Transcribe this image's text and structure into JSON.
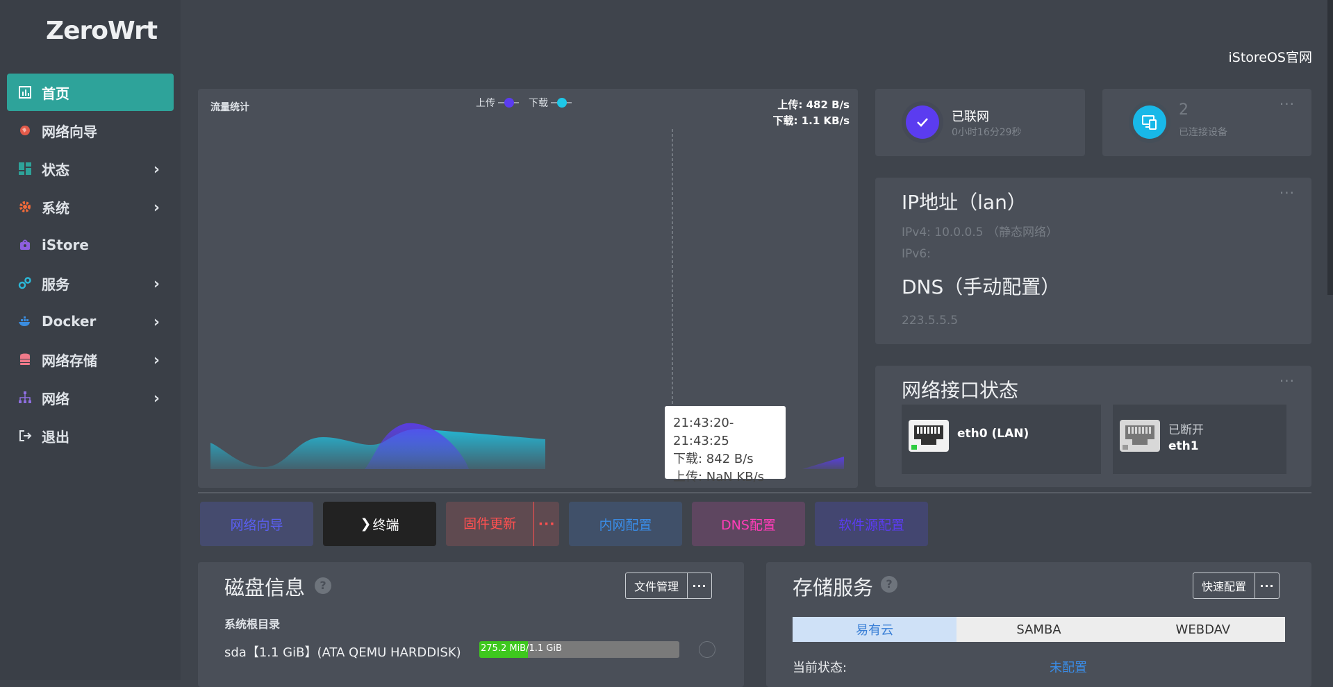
{
  "app": {
    "logo": "ZeroWrt",
    "top_link": "iStoreOS官网"
  },
  "sidebar": {
    "items": [
      {
        "label": "首页",
        "icon": "dashboard-icon",
        "active": true,
        "has_children": false
      },
      {
        "label": "网络向导",
        "icon": "globe-icon",
        "active": false,
        "has_children": false
      },
      {
        "label": "状态",
        "icon": "grid-icon",
        "active": false,
        "has_children": true
      },
      {
        "label": "系统",
        "icon": "gear-icon",
        "active": false,
        "has_children": true
      },
      {
        "label": "iStore",
        "icon": "store-icon",
        "active": false,
        "has_children": false
      },
      {
        "label": "服务",
        "icon": "services-icon",
        "active": false,
        "has_children": true
      },
      {
        "label": "Docker",
        "icon": "docker-icon",
        "active": false,
        "has_children": true
      },
      {
        "label": "网络存储",
        "icon": "database-icon",
        "active": false,
        "has_children": true
      },
      {
        "label": "网络",
        "icon": "network-icon",
        "active": false,
        "has_children": true
      },
      {
        "label": "退出",
        "icon": "logout-icon",
        "active": false,
        "has_children": false
      }
    ]
  },
  "traffic": {
    "title": "流量统计",
    "legend": {
      "upload": "上传",
      "download": "下载"
    },
    "upload_rate": "上传: 482 B/s",
    "download_rate": "下载: 1.1 KB/s",
    "tooltip": {
      "time": "21:43:20-21:43:25",
      "download": "下载: 842 B/s",
      "upload": "上传: NaN KB/s"
    },
    "colors": {
      "upload": "#5b3cf0",
      "download": "#1ec8e8"
    }
  },
  "connection": {
    "title": "已联网",
    "uptime": "0小时16分29秒"
  },
  "devices": {
    "count": "2",
    "label": "已连接设备"
  },
  "ip": {
    "title": "IP地址（lan）",
    "ipv4": "IPv4: 10.0.0.5 （静态网络）",
    "ipv6": "IPv6:",
    "dns_title": "DNS（手动配置）",
    "dns": "223.5.5.5"
  },
  "interfaces": {
    "title": "网络接口状态",
    "ports": [
      {
        "name": "eth0 (LAN)",
        "status": ""
      },
      {
        "name": "eth1",
        "status": "已断开"
      }
    ]
  },
  "quick_buttons": {
    "wizard": "网络向导",
    "terminal": "终端",
    "firmware": "固件更新",
    "lan": "内网配置",
    "dns": "DNS配置",
    "source": "软件源配置"
  },
  "disk": {
    "title": "磁盘信息",
    "manage_btn": "文件管理",
    "root_label": "系统根目录",
    "device": "sda【1.1 GiB】(ATA QEMU HARDDISK)",
    "used": "275.2 MiB",
    "total": "/1.1 GiB",
    "used_fraction": 0.244
  },
  "storage": {
    "title": "存储服务",
    "config_btn": "快速配置",
    "tabs": [
      "易有云",
      "SAMBA",
      "WEBDAV"
    ],
    "status_label": "当前状态:",
    "status_value": "未配置"
  }
}
